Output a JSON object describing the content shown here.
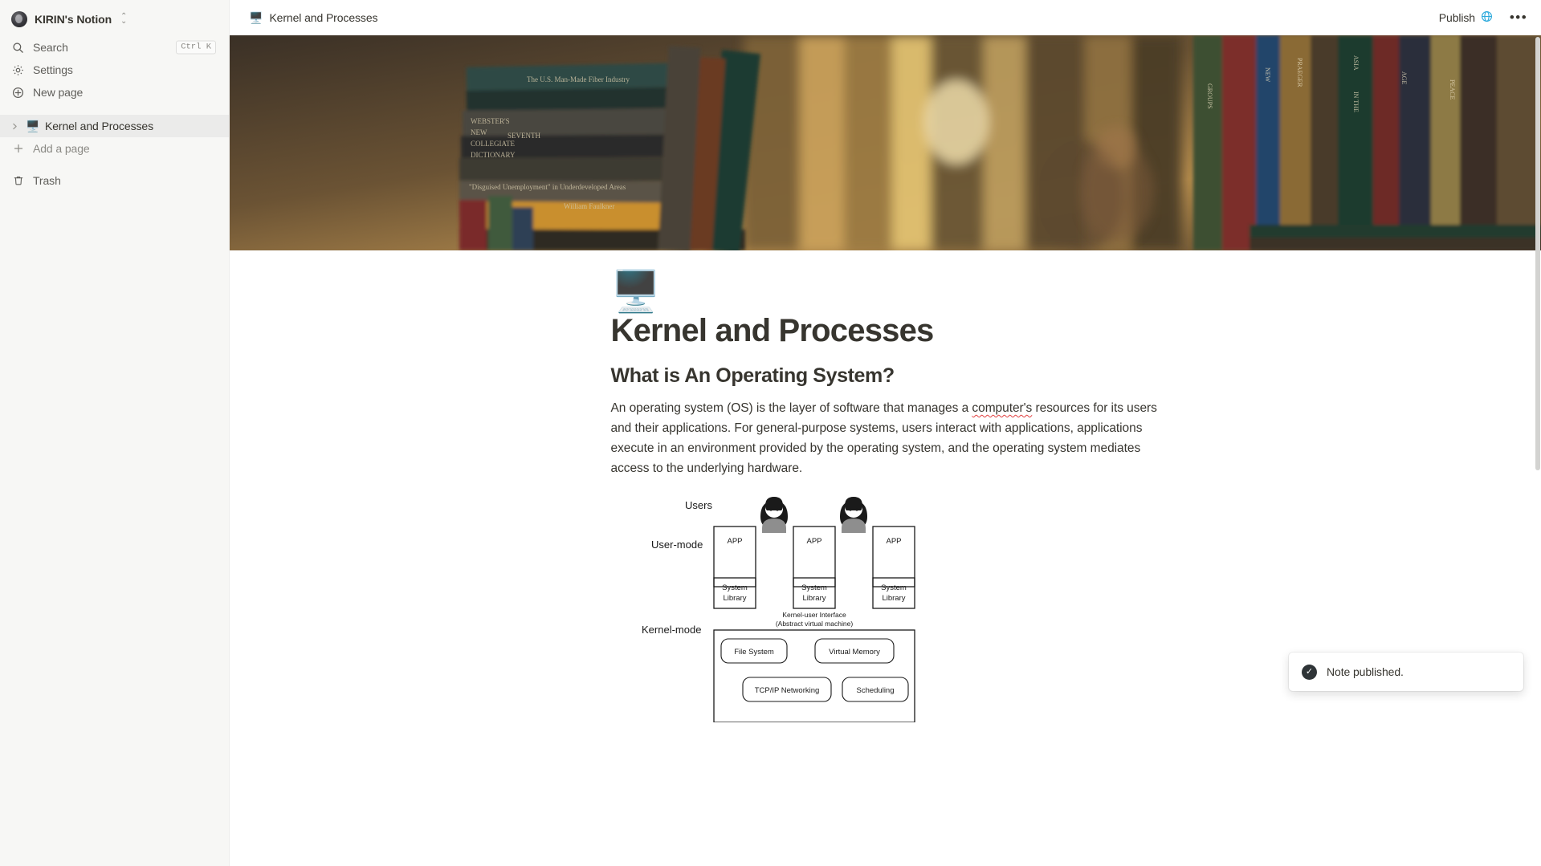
{
  "sidebar": {
    "workspace": {
      "name": "KIRIN's Notion",
      "avatar_icon": "avatar-image",
      "switcher_icon": "chevron-updown-icon"
    },
    "nav": [
      {
        "id": "search",
        "label": "Search",
        "icon": "search-icon",
        "shortcut": "Ctrl K"
      },
      {
        "id": "settings",
        "label": "Settings",
        "icon": "gear-icon",
        "shortcut": ""
      },
      {
        "id": "new-page",
        "label": "New page",
        "icon": "plus-circle-icon",
        "shortcut": ""
      }
    ],
    "pages": [
      {
        "id": "kernel-and-processes",
        "label": "Kernel and Processes",
        "emoji": "🖥️",
        "twisty": "chevron-right-icon",
        "selected": true
      }
    ],
    "add_page": {
      "label": "Add a page",
      "icon": "plus-icon"
    },
    "trash": {
      "label": "Trash",
      "icon": "trash-icon"
    }
  },
  "topbar": {
    "breadcrumb": {
      "emoji": "🖥️",
      "title": "Kernel and Processes"
    },
    "publish": {
      "label": "Publish",
      "icon": "globe-icon",
      "icon_color": "#2eaadc"
    },
    "more": {
      "icon": "ellipsis-icon",
      "label": "•••"
    }
  },
  "page": {
    "cover_alt": "bookshelf-cover-image",
    "emoji": "🖥️",
    "title": "Kernel and Processes",
    "heading2": "What is An Operating System?",
    "paragraph_parts": {
      "before": "An operating system (OS) is the layer of software that manages a ",
      "misspelled": "computer's",
      "after": " resources for its users and their applications. For general-purpose systems, users interact with applications, applications execute in an environment provided by the operating system, and the operating system mediates access to the underlying hardware."
    },
    "paragraph_full": "An operating system (OS) is the layer of software that manages a computer's resources for its users and their applications. For general-purpose systems, users interact with applications, applications execute in an environment provided by the operating system, and the operating system mediates access to the underlying hardware."
  },
  "diagram": {
    "row_labels": [
      "Users",
      "User-mode",
      "Kernel-mode"
    ],
    "user_icons": [
      "user-avatar-1",
      "user-avatar-2"
    ],
    "app_boxes": [
      {
        "app": "APP",
        "library": "System Library"
      },
      {
        "app": "APP",
        "library": "System Library"
      },
      {
        "app": "APP",
        "library": "System Library"
      }
    ],
    "interface_label_line1": "Kernel-user Interface",
    "interface_label_line2": "(Abstract virtual machine)",
    "kernel_services": [
      "File System",
      "Virtual Memory",
      "TCP/IP Networking",
      "Scheduling"
    ]
  },
  "toast": {
    "icon": "check-circle-icon",
    "message": "Note published."
  }
}
